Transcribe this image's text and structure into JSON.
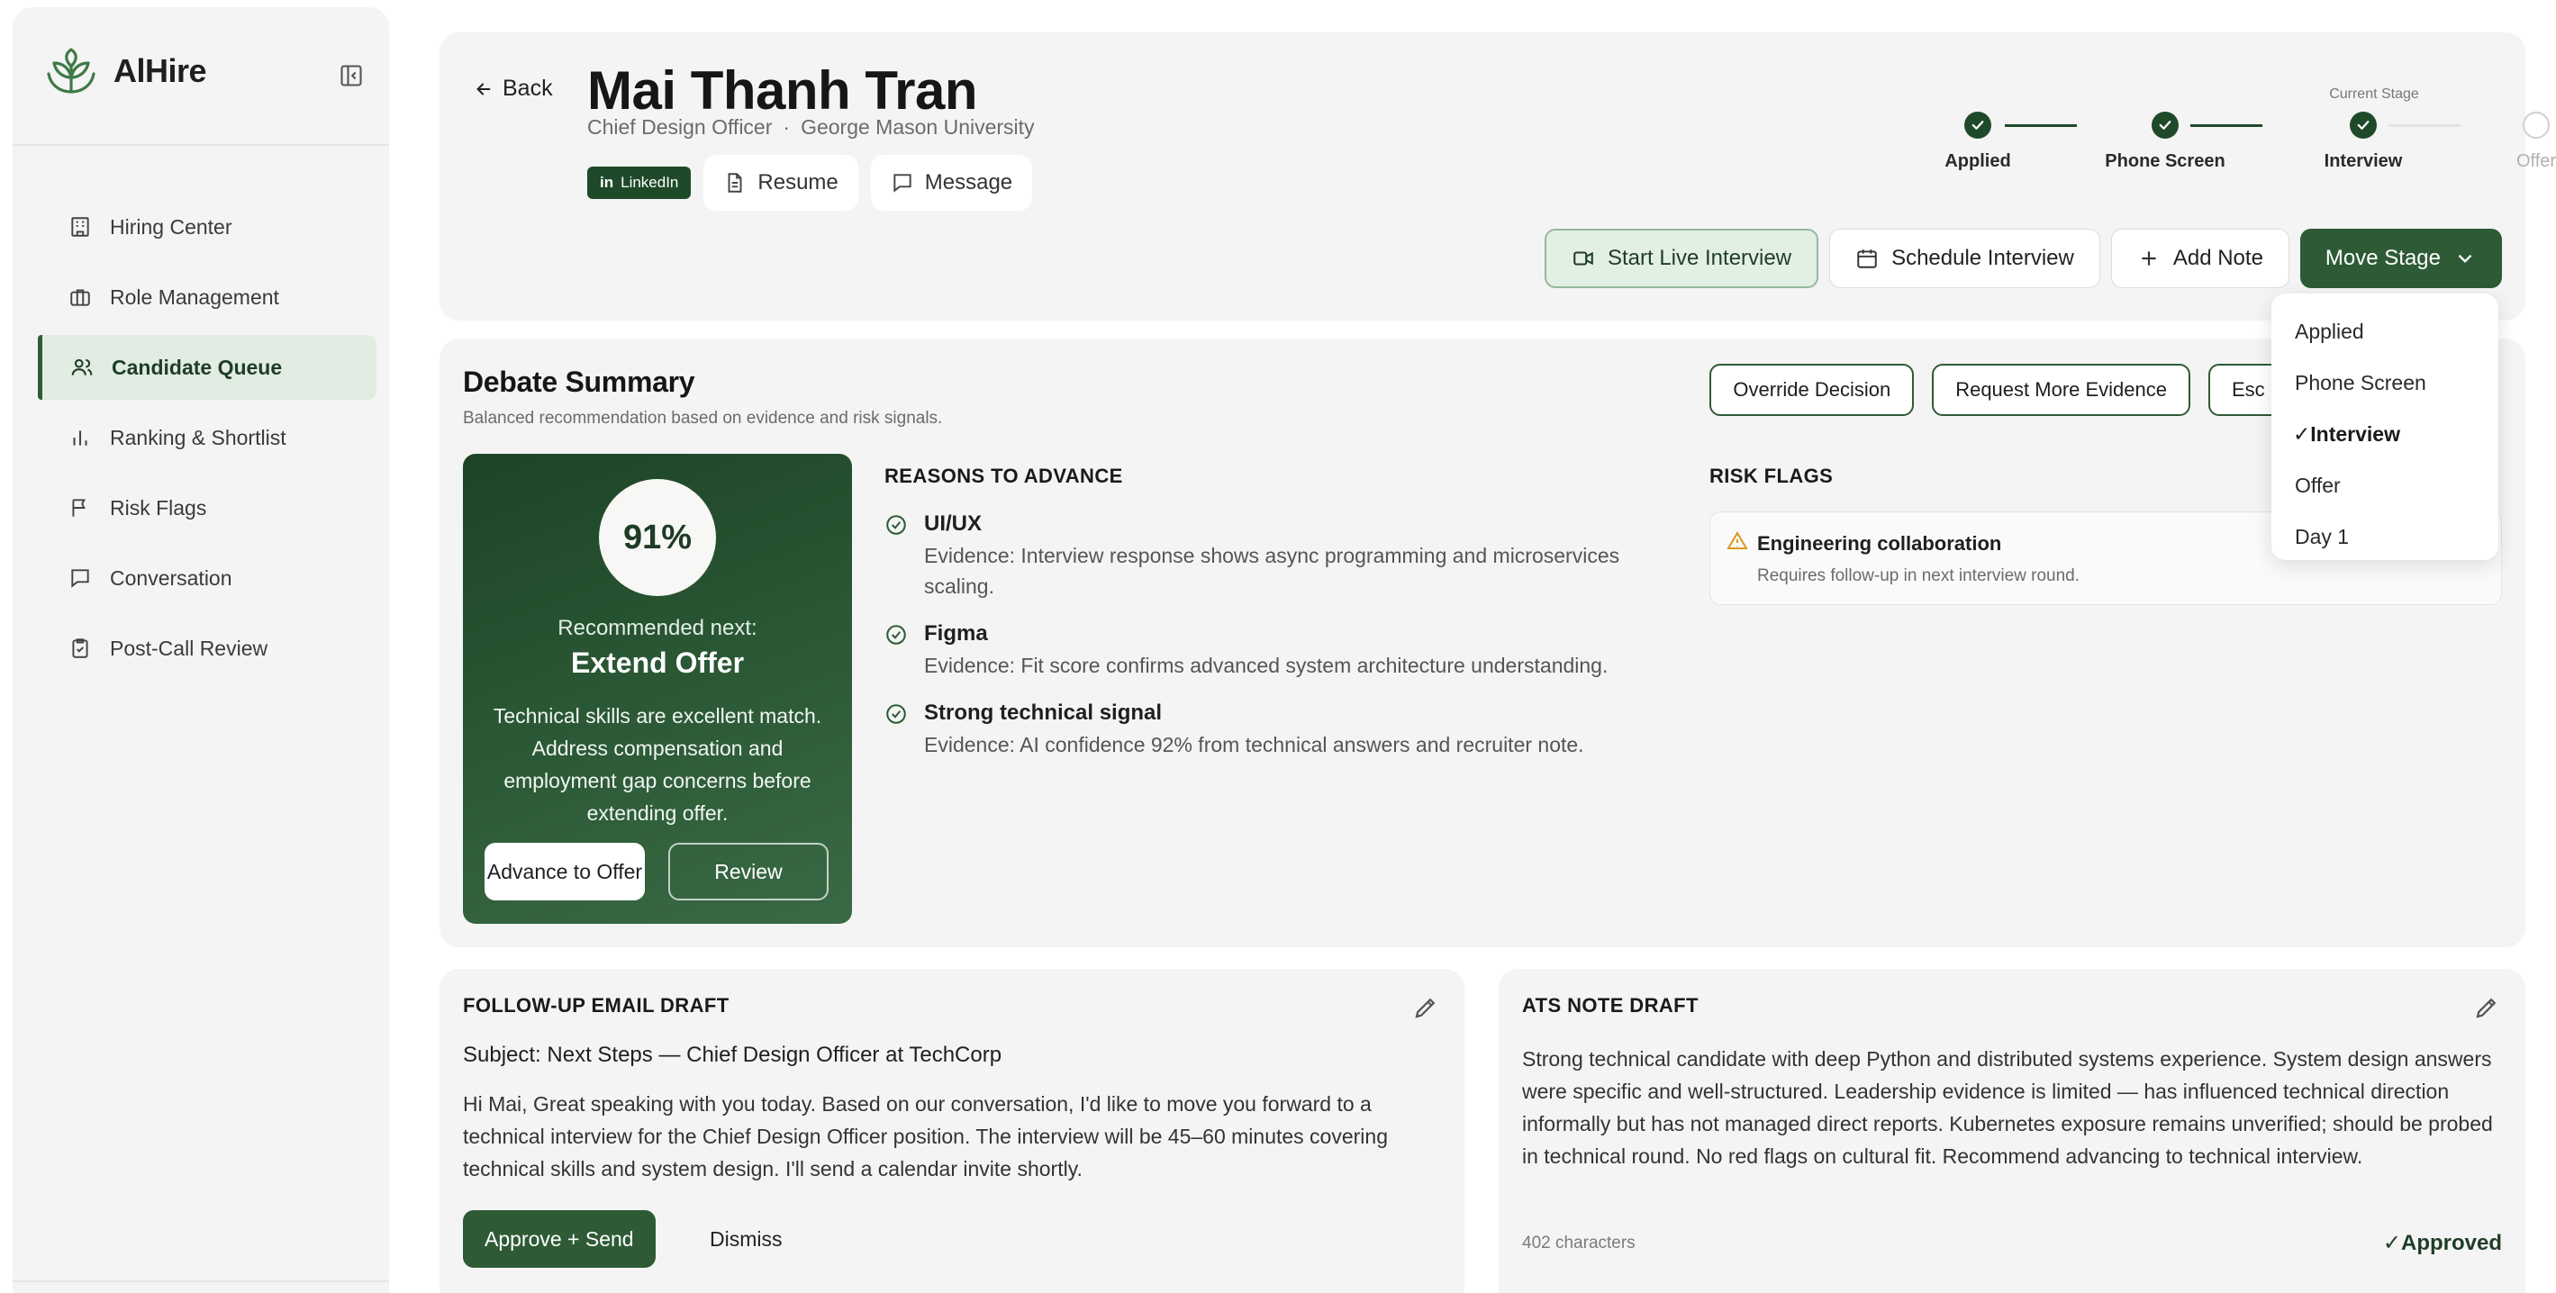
{
  "app": {
    "name": "AlHire",
    "brand_color": "#2e5b36"
  },
  "sidebar": {
    "items": [
      {
        "label": "Hiring Center",
        "icon": "building-icon"
      },
      {
        "label": "Role Management",
        "icon": "briefcase-icon"
      },
      {
        "label": "Candidate Queue",
        "icon": "users-icon",
        "active": true
      },
      {
        "label": "Ranking & Shortlist",
        "icon": "bar-chart-icon"
      },
      {
        "label": "Risk Flags",
        "icon": "flag-icon"
      },
      {
        "label": "Conversation",
        "icon": "chat-icon"
      },
      {
        "label": "Post-Call Review",
        "icon": "clipboard-check-icon"
      }
    ]
  },
  "header": {
    "back_label": "Back",
    "candidate_name": "Mai Thanh Tran",
    "role": "Chief Design Officer",
    "separator": "·",
    "school": "George Mason University",
    "linkedin_label": "LinkedIn",
    "resume_label": "Resume",
    "message_label": "Message"
  },
  "stepper": {
    "current_label": "Current Stage",
    "steps": [
      {
        "label": "Applied",
        "status": "done"
      },
      {
        "label": "Phone Screen",
        "status": "done"
      },
      {
        "label": "Interview",
        "status": "current"
      },
      {
        "label": "Offer",
        "status": "todo"
      }
    ]
  },
  "actions": {
    "start_live": "Start Live Interview",
    "schedule": "Schedule Interview",
    "add_note": "Add Note",
    "move_stage": "Move Stage"
  },
  "dropdown": {
    "options": [
      "Applied",
      "Phone Screen",
      "✓Interview",
      "Offer",
      "Day 1"
    ],
    "selected_index": 2
  },
  "debate": {
    "title": "Debate Summary",
    "subtitle": "Balanced recommendation based on evidence and risk signals.",
    "override_label": "Override Decision",
    "request_label": "Request More Evidence",
    "escalate_label": "Esc",
    "score": "91%",
    "recommended_label": "Recommended next:",
    "recommended_action": "Extend Offer",
    "recommendation_text": "Technical skills are excellent match. Address compensation and employment gap concerns before extending offer.",
    "advance_label": "Advance to Offer",
    "review_label": "Review",
    "reasons_heading": "REASONS TO ADVANCE",
    "reasons": [
      {
        "title": "UI/UX",
        "evidence": "Evidence: Interview response shows async programming and microservices scaling."
      },
      {
        "title": "Figma",
        "evidence": "Evidence: Fit score confirms advanced system architecture understanding."
      },
      {
        "title": "Strong technical signal",
        "evidence": "Evidence: AI confidence 92% from technical answers and recruiter note."
      }
    ],
    "risks_heading": "RISK FLAGS",
    "risks": [
      {
        "title": "Engineering collaboration",
        "detail": "Requires follow-up in next interview round."
      }
    ]
  },
  "email": {
    "heading": "FOLLOW-UP EMAIL DRAFT",
    "subject": "Subject: Next Steps — Chief Design Officer at TechCorp",
    "body": "Hi Mai, Great speaking with you today. Based on our conversation, I'd like to move you forward to a technical interview for the Chief Design Officer position. The interview will be 45–60 minutes covering technical skills and system design. I'll send a calendar invite shortly.",
    "approve_label": "Approve + Send",
    "dismiss_label": "Dismiss"
  },
  "ats": {
    "heading": "ATS NOTE DRAFT",
    "body": "Strong technical candidate with deep Python and distributed systems experience. System design answers were specific and well-structured. Leadership evidence is limited — has influenced technical direction informally but has not managed direct reports. Kubernetes exposure remains unverified; should be probed in technical round. No red flags on cultural fit. Recommend advancing to technical interview.",
    "char_count": "402 characters",
    "status": "✓Approved"
  }
}
